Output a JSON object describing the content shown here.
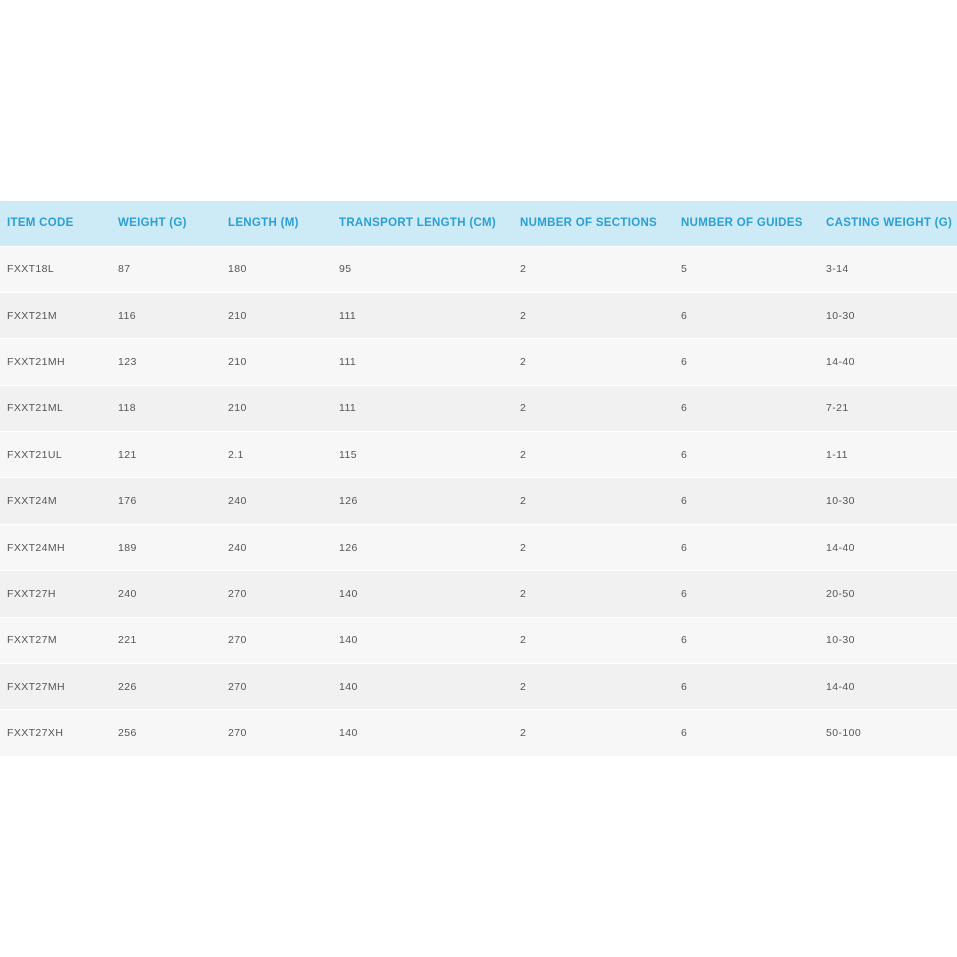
{
  "table": {
    "headers": [
      "ITEM CODE",
      "WEIGHT (G)",
      "LENGTH (M)",
      "TRANSPORT LENGTH (CM)",
      "NUMBER OF SECTIONS",
      "NUMBER OF GUIDES",
      "CASTING WEIGHT (G)"
    ],
    "rows": [
      [
        "FXXT18L",
        "87",
        "180",
        "95",
        "2",
        "5",
        "3-14"
      ],
      [
        "FXXT21M",
        "116",
        "210",
        "111",
        "2",
        "6",
        "10-30"
      ],
      [
        "FXXT21MH",
        "123",
        "210",
        "111",
        "2",
        "6",
        "14-40"
      ],
      [
        "FXXT21ML",
        "118",
        "210",
        "111",
        "2",
        "6",
        "7-21"
      ],
      [
        "FXXT21UL",
        "121",
        "2.1",
        "115",
        "2",
        "6",
        "1-11"
      ],
      [
        "FXXT24M",
        "176",
        "240",
        "126",
        "2",
        "6",
        "10-30"
      ],
      [
        "FXXT24MH",
        "189",
        "240",
        "126",
        "2",
        "6",
        "14-40"
      ],
      [
        "FXXT27H",
        "240",
        "270",
        "140",
        "2",
        "6",
        "20-50"
      ],
      [
        "FXXT27M",
        "221",
        "270",
        "140",
        "2",
        "6",
        "10-30"
      ],
      [
        "FXXT27MH",
        "226",
        "270",
        "140",
        "2",
        "6",
        "14-40"
      ],
      [
        "FXXT27XH",
        "256",
        "270",
        "140",
        "2",
        "6",
        "50-100"
      ]
    ]
  },
  "colors": {
    "header_background": "#cdeaf7",
    "header_text": "#2a9fd6",
    "row_odd": "#f7f7f7",
    "row_even": "#f1f1f1",
    "cell_text": "#555555"
  }
}
